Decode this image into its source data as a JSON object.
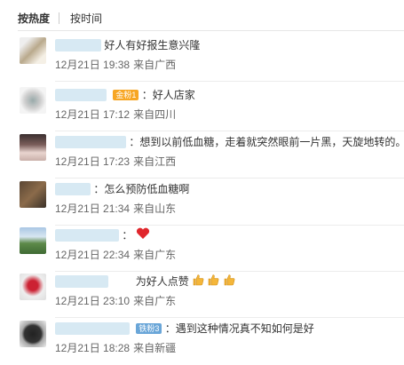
{
  "sort_tabs": {
    "hot": "按热度",
    "time": "按时间"
  },
  "comments": [
    {
      "text": "好人有好报生意兴隆",
      "date": "12月21日 19:38",
      "source": "来自广西",
      "badge": ""
    },
    {
      "text": "：好人店家",
      "date": "12月21日 17:12",
      "source": "来自四川",
      "badge": "金粉1"
    },
    {
      "text": "：想到以前低血糖，走着就突然眼前一片黑，天旋地转的。",
      "date": "12月21日 17:23",
      "source": "来自江西",
      "badge": ""
    },
    {
      "text": "：怎么预防低血糖啊",
      "date": "12月21日 21:34",
      "source": "来自山东",
      "badge": ""
    },
    {
      "text": "：",
      "date": "12月21日 22:34",
      "source": "来自广东",
      "badge": "",
      "emoji": "heart-icon"
    },
    {
      "text": "为好人点赞",
      "date": "12月21日 23:10",
      "source": "来自广东",
      "badge": "",
      "emoji": "thumbs-up-icon"
    },
    {
      "text": "：遇到这种情况真不知如何是好",
      "date": "12月21日 18:28",
      "source": "来自新疆",
      "badge": "铁粉3"
    }
  ],
  "colors": {
    "heart": "#e0262c",
    "thumb": "#f4b63a",
    "gold_badge": "#f7a623",
    "iron_badge": "#6aa6d8"
  }
}
